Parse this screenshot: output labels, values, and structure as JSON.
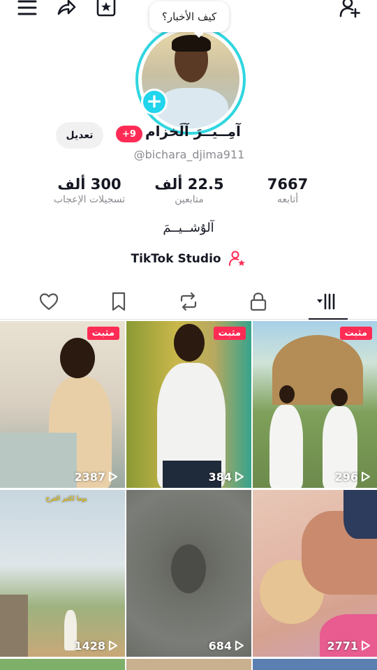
{
  "topbar": {
    "icons": [
      "menu-icon",
      "share-icon",
      "favorites-icon",
      "add-friend-icon"
    ]
  },
  "profile": {
    "bubble_text": "كيف الأخبار؟",
    "display_name": "آمِــيــرَ آلَخزام",
    "badge": "+9",
    "edit_label": "تعديل",
    "handle": "@bichara_djima911",
    "bio": "آلۇشــيــمَ",
    "studio_label": "TikTok Studio"
  },
  "stats": [
    {
      "value": "7667",
      "label": "أتابعه"
    },
    {
      "value": "22.5 ألف",
      "label": "متابعين"
    },
    {
      "value": "300 ألف",
      "label": "تسجيلات الإعجاب"
    }
  ],
  "tabs": [
    {
      "name": "videos",
      "icon": "grid-dropdown-icon",
      "active": true
    },
    {
      "name": "private",
      "icon": "lock-icon"
    },
    {
      "name": "reposts",
      "icon": "repost-icon"
    },
    {
      "name": "favorites",
      "icon": "bookmark-icon"
    },
    {
      "name": "liked",
      "icon": "heart-icon"
    }
  ],
  "videos": [
    {
      "views": "2387",
      "pinned": "مثبت"
    },
    {
      "views": "384",
      "pinned": "مثبت"
    },
    {
      "views": "296",
      "pinned": "مثبت"
    },
    {
      "views": "1428",
      "overlay": "يوما لكثير الفرح"
    },
    {
      "views": "684"
    },
    {
      "views": "2771"
    }
  ],
  "colors": {
    "accent": "#fe2c55",
    "ring": "#2fd6e0",
    "text": "#161823",
    "muted": "#8a8b91"
  }
}
